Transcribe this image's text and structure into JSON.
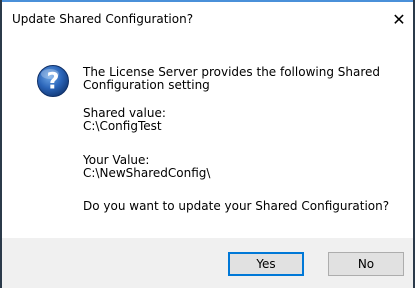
{
  "dialog": {
    "title": "Update Shared Configuration?",
    "close_symbol": "✕",
    "icon": "question-icon",
    "accent_color": "#1e5aa8"
  },
  "message": {
    "line1": "The License Server provides the following Shared",
    "line2": "Configuration setting",
    "shared_label": "Shared value:",
    "shared_value": "C:\\ConfigTest",
    "your_label": "Your Value:",
    "your_value": "C:\\NewSharedConfig\\",
    "question": "Do you want to update your Shared Configuration?"
  },
  "buttons": {
    "yes_label": "Yes",
    "no_label": "No"
  }
}
